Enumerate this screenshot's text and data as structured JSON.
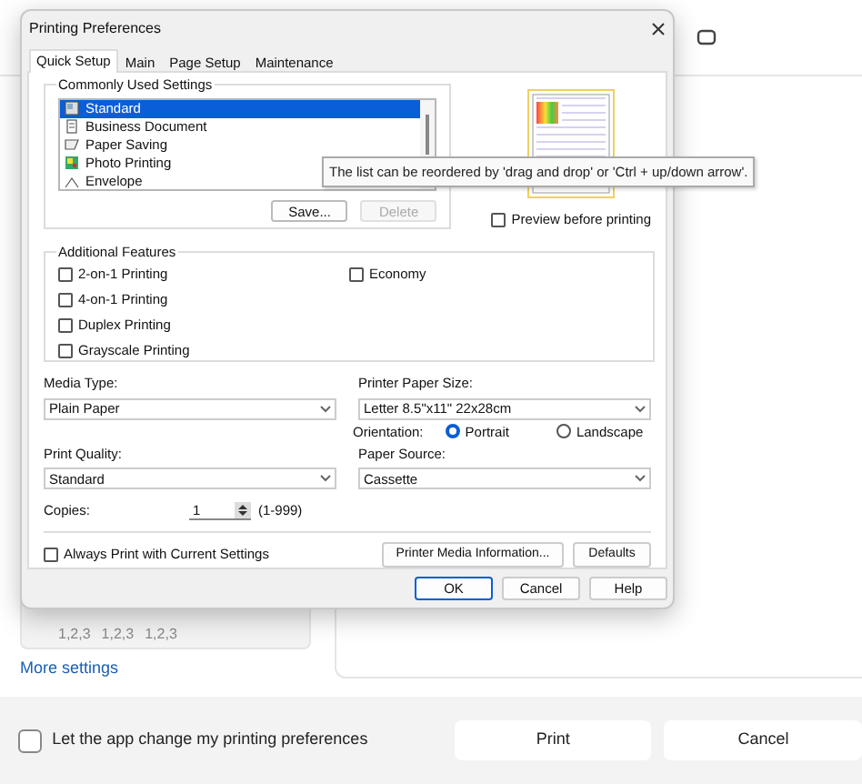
{
  "background": {
    "collation": {
      "labels": [
        "1,2,3",
        "1,2,3",
        "1,2,3"
      ]
    },
    "more_settings_link": "More settings",
    "footer": {
      "app_change_checkbox": {
        "label": "Let the app change my printing preferences",
        "checked": false
      },
      "buttons": [
        "Print",
        "Cancel"
      ]
    }
  },
  "dialog": {
    "title": "Printing Preferences",
    "tabs": [
      {
        "label": "Quick Setup",
        "selected": true
      },
      {
        "label": "Main",
        "selected": false
      },
      {
        "label": "Page Setup",
        "selected": false
      },
      {
        "label": "Maintenance",
        "selected": false
      }
    ],
    "commonly_used_settings": {
      "title": "Commonly Used Settings",
      "items": [
        {
          "label": "Standard",
          "selected": true,
          "kind": "standard"
        },
        {
          "label": "Business Document",
          "selected": false,
          "kind": "document"
        },
        {
          "label": "Paper Saving",
          "selected": false,
          "kind": "saving"
        },
        {
          "label": "Photo Printing",
          "selected": false,
          "kind": "photo"
        },
        {
          "label": "Envelope",
          "selected": false,
          "kind": "envelope"
        }
      ],
      "buttons": [
        {
          "label": "Save...",
          "disabled": false
        },
        {
          "label": "Delete",
          "disabled": true
        }
      ]
    },
    "tooltip": "The list can be reordered by 'drag and drop' or 'Ctrl + up/down arrow'.",
    "preview_checkbox": {
      "label": "Preview before printing",
      "checked": false
    },
    "additional_features": {
      "title": "Additional Features",
      "items": [
        {
          "label": "2-on-1 Printing",
          "checked": false
        },
        {
          "label": "4-on-1 Printing",
          "checked": false
        },
        {
          "label": "Duplex Printing",
          "checked": false
        },
        {
          "label": "Grayscale Printing",
          "checked": false
        },
        {
          "label": "Economy",
          "checked": false
        }
      ]
    },
    "media_type": {
      "label": "Media Type:",
      "value": "Plain Paper"
    },
    "printer_paper_size": {
      "label": "Printer Paper Size:",
      "value": "Letter 8.5\"x11\" 22x28cm"
    },
    "orientation": {
      "label": "Orientation:",
      "options": [
        {
          "label": "Portrait",
          "selected": true
        },
        {
          "label": "Landscape",
          "selected": false
        }
      ]
    },
    "print_quality": {
      "label": "Print Quality:",
      "value": "Standard"
    },
    "paper_source": {
      "label": "Paper Source:",
      "value": "Cassette"
    },
    "copies": {
      "label": "Copies:",
      "value": "1",
      "range": "(1-999)"
    },
    "always_print_checkbox": {
      "label": "Always Print with Current Settings",
      "checked": false
    },
    "panel_buttons": [
      "Printer Media Information...",
      "Defaults"
    ],
    "dialog_buttons": [
      "OK",
      "Cancel",
      "Help"
    ]
  }
}
